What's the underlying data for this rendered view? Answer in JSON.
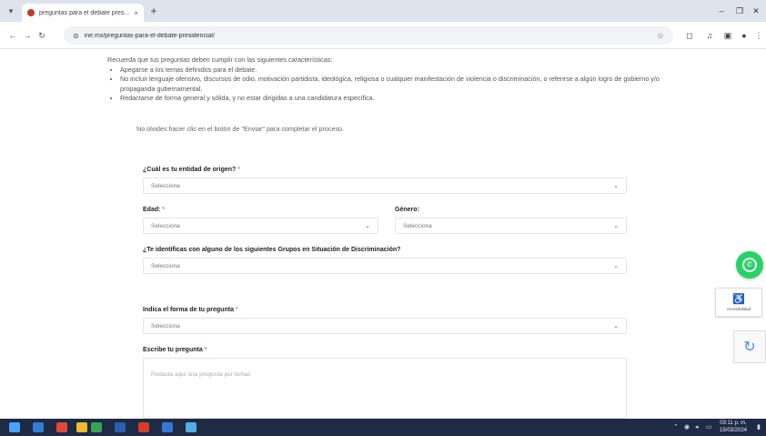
{
  "browser": {
    "tab_title": "preguntas para el debate pres...",
    "tab_close": "×",
    "new_tab": "+",
    "url": "ine.mx/preguntas-para-el-debate-presidencial/",
    "window_controls": [
      "–",
      "❐",
      "✕"
    ]
  },
  "intro": {
    "lead": "Recuerda que tus preguntas deben cumplir con las siguientes características:",
    "bullets": [
      "Apegarse a los temas definidos para el debate.",
      "No incluir lenguaje ofensivo, discursos de odio, motivación partidista, ideológica, religiosa o cualquier manifestación de violencia o discriminación, o referirse a algún logro de gobierno y/o propaganda gubernamental.",
      "Redactarse de forma general y sólida, y no estar dirigidas a una candidatura específica."
    ],
    "hint": "No olvides hacer clic en el botón de \"Enviar\" para completar el proceso."
  },
  "form": {
    "entidad_label": "¿Cuál es tu entidad de origen?",
    "edad_label": "Edad:",
    "genero_label": "Género:",
    "grupo_label": "¿Te identificas con alguno de los siguientes Grupos en Situación de Discriminación?",
    "forma_label": "Indica el forma de tu pregunta",
    "pregunta_label": "Escribe tu pregunta",
    "required_mark": "*",
    "select_placeholder": "Selecciona",
    "textarea_placeholder": "Redacta aquí una pregunta por temas"
  },
  "widgets": {
    "accessibility_label": "Accesibilidad"
  },
  "taskbar": {
    "time": "03:11 p. m.",
    "date": "15/03/2024"
  },
  "colors": {
    "whatsapp": "#25d366",
    "taskbar": "#1f2a44",
    "tab_bar": "#dfe3eb"
  }
}
